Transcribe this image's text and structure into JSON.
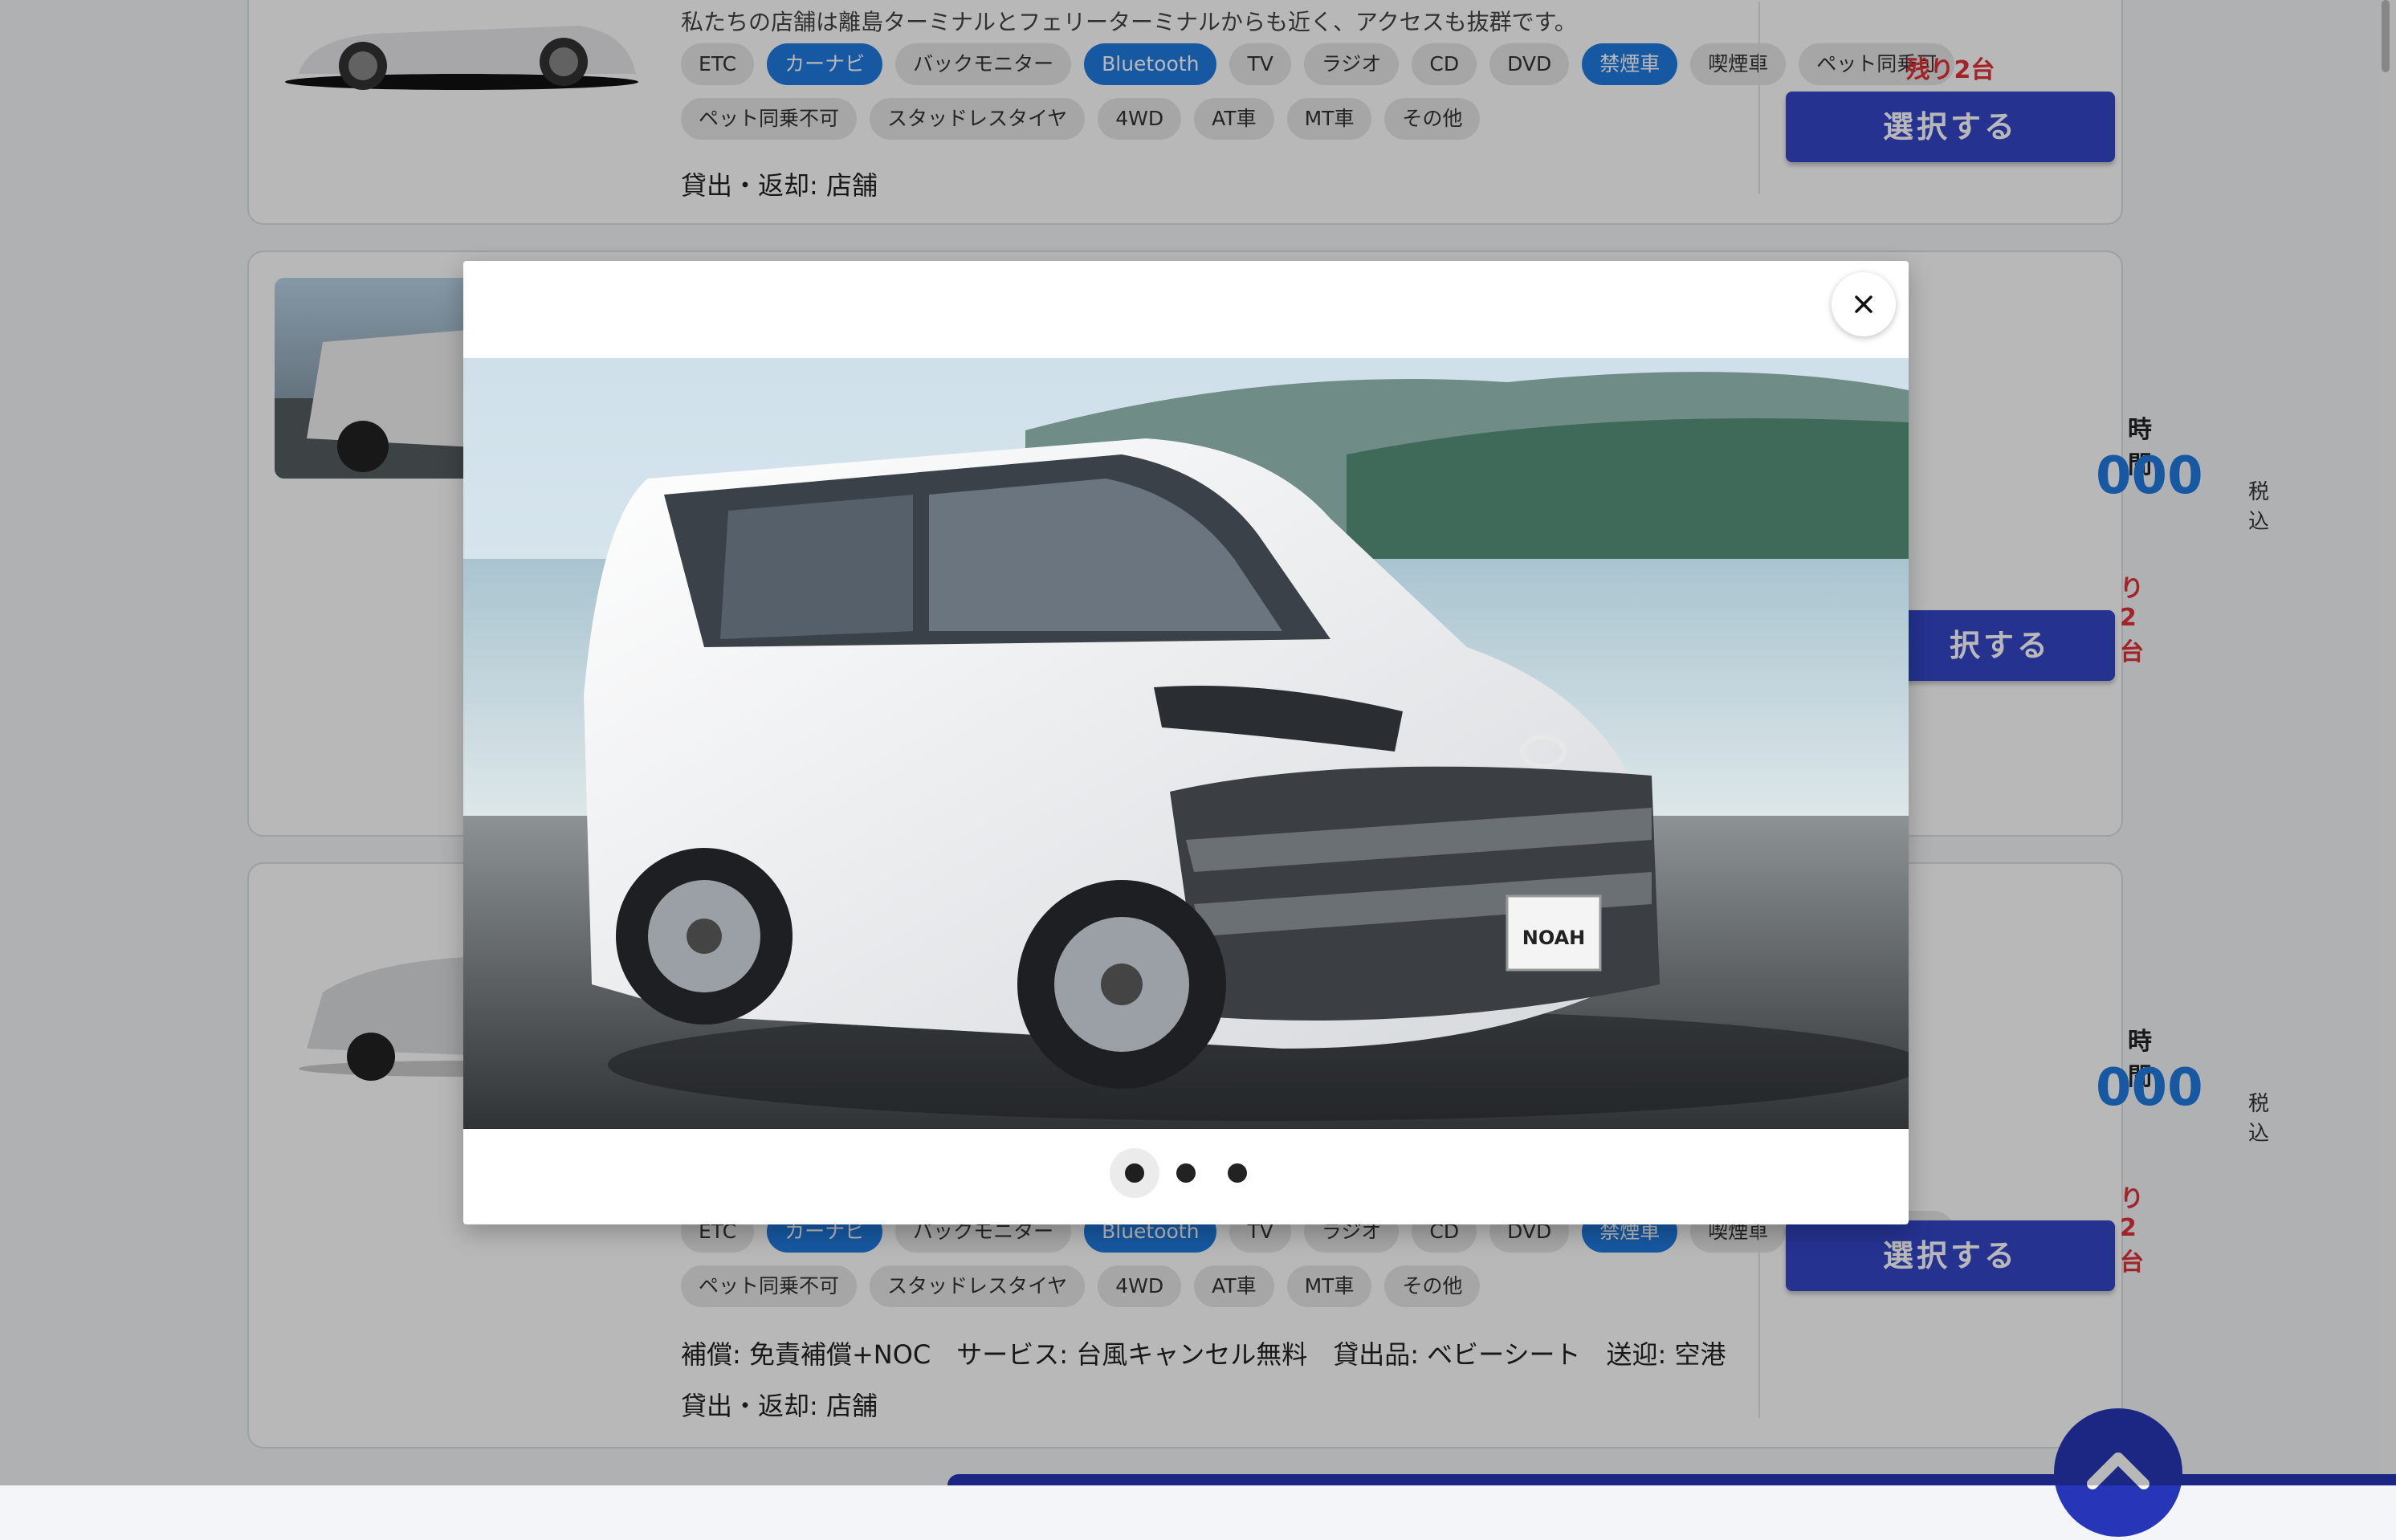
{
  "tags_row1": [
    "ETC",
    "カーナビ",
    "バックモニター",
    "Bluetooth",
    "TV",
    "ラジオ",
    "CD",
    "DVD",
    "禁煙車",
    "喫煙車"
  ],
  "tags_row2": [
    "ペット同乗可",
    "ペット同乗不可",
    "スタッドレスタイヤ",
    "4WD",
    "AT車",
    "MT車",
    "その他"
  ],
  "active_tags": [
    "カーナビ",
    "Bluetooth",
    "禁煙車"
  ],
  "card1": {
    "desc": "私たちの店舗は離島ターミナルとフェリーターミナルからも近く、アクセスも抜群です。",
    "pickup": "貸出・返却: 店舗",
    "remaining": "残り2台",
    "select_label": "選択する"
  },
  "card2": {
    "hours": "時間",
    "price": "000",
    "tax": "税込",
    "remaining": "り2台",
    "select_label": "択する"
  },
  "card3": {
    "hours": "時間",
    "price": "000",
    "tax": "税込",
    "remaining": "り2台",
    "select_label": "選択する",
    "services": "補償: 免責補償+NOC　サービス: 台風キャンセル無料　貸出品: ベビーシート　送迎: 空港",
    "pickup": "貸出・返却: 店舗"
  },
  "modal": {
    "close_icon": "close-icon",
    "plate_text": "NOAH",
    "slide_count": 3,
    "active_slide": 1
  },
  "colors": {
    "tag_active": "#1f7ae0",
    "button": "#3446c8",
    "remaining": "#e0333a",
    "price": "#1f7ae0"
  }
}
